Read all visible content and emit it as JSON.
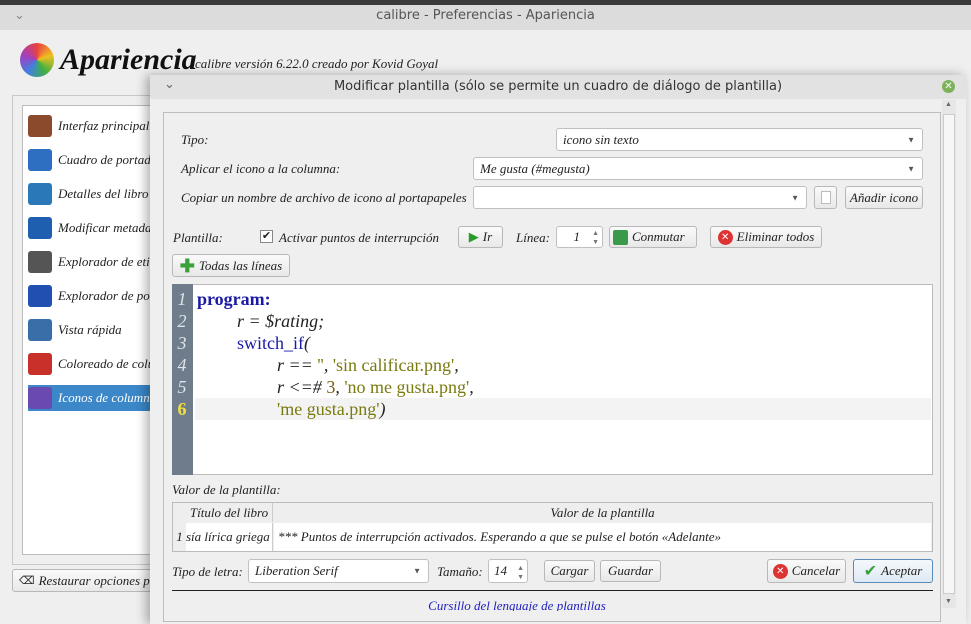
{
  "window": {
    "title": "calibre - Preferencias - Apariencia"
  },
  "header": {
    "title": "Apariencia",
    "version": "calibre versión 6.22.0 creado por Kovid Goyal"
  },
  "sidebar": {
    "items": [
      {
        "label": "Interfaz principal",
        "icon": "books-icon",
        "color": "#8b4a2b"
      },
      {
        "label": "Cuadro de portadas",
        "icon": "grid-icon",
        "color": "#2f6fc1"
      },
      {
        "label": "Detalles del libro",
        "icon": "book-icon",
        "color": "#2a78b8"
      },
      {
        "label": "Modificar metadatos",
        "icon": "info-icon",
        "color": "#1f5fb0"
      },
      {
        "label": "Explorador de etiquetas",
        "icon": "tag-icon",
        "color": "#555555"
      },
      {
        "label": "Explorador de portadas",
        "icon": "cover-browser-icon",
        "color": "#1f4fb0"
      },
      {
        "label": "Vista rápida",
        "icon": "eye-icon",
        "color": "#3a6ea8"
      },
      {
        "label": "Coloreado de columnas",
        "icon": "paint-icon",
        "color": "#c8302a"
      },
      {
        "label": "Iconos de columnas",
        "icon": "icon-brush-icon",
        "color": "#6a4ab0",
        "selected": true
      }
    ],
    "restore_button": "Restaurar opciones predeterminadas"
  },
  "dialog": {
    "title": "Modificar plantilla (sólo se permite un cuadro de diálogo de plantilla)",
    "tipo_label": "Tipo:",
    "tipo_value": "icono sin texto",
    "aplicar_label": "Aplicar el icono a la columna:",
    "aplicar_value": "Me gusta (#megusta)",
    "copiar_label": "Copiar un nombre de archivo de icono al portapapeles",
    "copiar_value": "",
    "add_icon_button": "Añadir icono",
    "plantilla_label": "Plantilla:",
    "breakpoints_checkbox": "Activar puntos de interrupción",
    "breakpoints_checked": true,
    "go_button": "Ir",
    "line_label": "Línea:",
    "line_value": "1",
    "toggle_button": "Conmutar",
    "remove_all_button": "Eliminar todos",
    "all_lines_button": "Todas las líneas",
    "code_lines": [
      {
        "n": "1",
        "parts": [
          [
            "kw",
            "program:"
          ]
        ]
      },
      {
        "n": "2",
        "parts": [
          [
            "",
            "\t"
          ],
          [
            "",
            "r = $rating;"
          ]
        ]
      },
      {
        "n": "3",
        "parts": [
          [
            "",
            "\t"
          ],
          [
            "fn",
            "switch_if"
          ],
          [
            "",
            "("
          ]
        ]
      },
      {
        "n": "4",
        "parts": [
          [
            "",
            "\t\t"
          ],
          [
            "",
            "r == "
          ],
          [
            "str",
            "''"
          ],
          [
            "",
            ", "
          ],
          [
            "str",
            "'sin calificar.png'"
          ],
          [
            "",
            ","
          ]
        ]
      },
      {
        "n": "5",
        "parts": [
          [
            "",
            "\t\t"
          ],
          [
            "",
            "r <=# "
          ],
          [
            "num",
            "3"
          ],
          [
            "",
            ", "
          ],
          [
            "str",
            "'no me gusta.png'"
          ],
          [
            "",
            ","
          ]
        ]
      },
      {
        "n": "6",
        "parts": [
          [
            "",
            "\t\t"
          ],
          [
            "str",
            "'me gusta.png'"
          ],
          [
            "",
            ")"
          ]
        ]
      }
    ],
    "current_line": "6",
    "value_label": "Valor de la plantilla:",
    "table": {
      "headers": [
        "Título del libro",
        "Valor de la plantilla"
      ],
      "rows": [
        {
          "num": "1",
          "title": "sía lírica griega",
          "value": "*** Puntos de interrupción activados. Esperando a que se pulse el botón «Adelante»"
        }
      ]
    },
    "font_label": "Tipo de letra:",
    "font_value": "Liberation Serif",
    "size_label": "Tamaño:",
    "size_value": "14",
    "load_button": "Cargar",
    "save_button": "Guardar",
    "cancel_button": "Cancelar",
    "accept_button": "Aceptar",
    "tutorial_link": "Cursillo del lenguaje de plantillas"
  }
}
